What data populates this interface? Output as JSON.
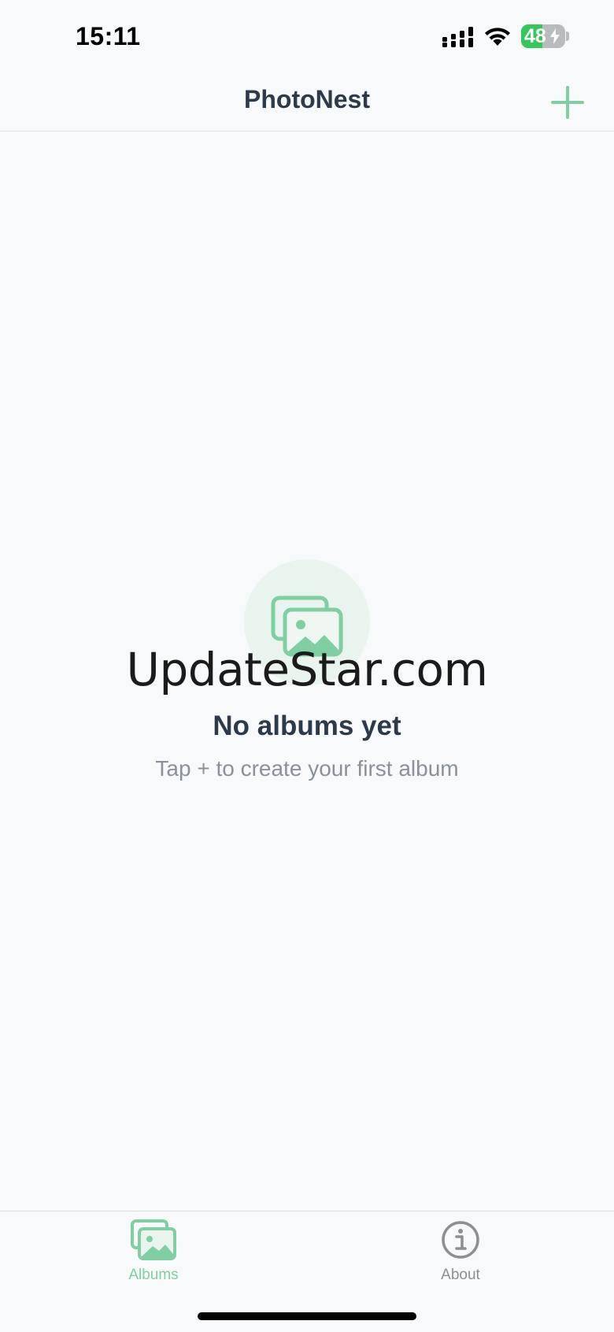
{
  "status_bar": {
    "time": "15:11",
    "battery_level": "48",
    "battery_fraction": 0.48,
    "icons": [
      "signal-icon",
      "wifi-icon",
      "battery-icon",
      "charging-bolt-icon"
    ]
  },
  "nav": {
    "title": "PhotoNest",
    "add_icon": "plus-icon"
  },
  "empty_state": {
    "icon": "photo-stack-icon",
    "watermark": "UpdateStar.com",
    "title": "No albums yet",
    "subtitle": "Tap + to create your first album"
  },
  "tabs": [
    {
      "label": "Albums",
      "icon": "photo-stack-icon",
      "selected": true
    },
    {
      "label": "About",
      "icon": "info-circle-icon",
      "selected": false
    }
  ],
  "colors": {
    "accent": "#7fcfa3",
    "background": "#f7f9fb",
    "title_text": "#2d3a4a",
    "secondary_text": "#8a9199",
    "battery_green": "#34c759"
  }
}
